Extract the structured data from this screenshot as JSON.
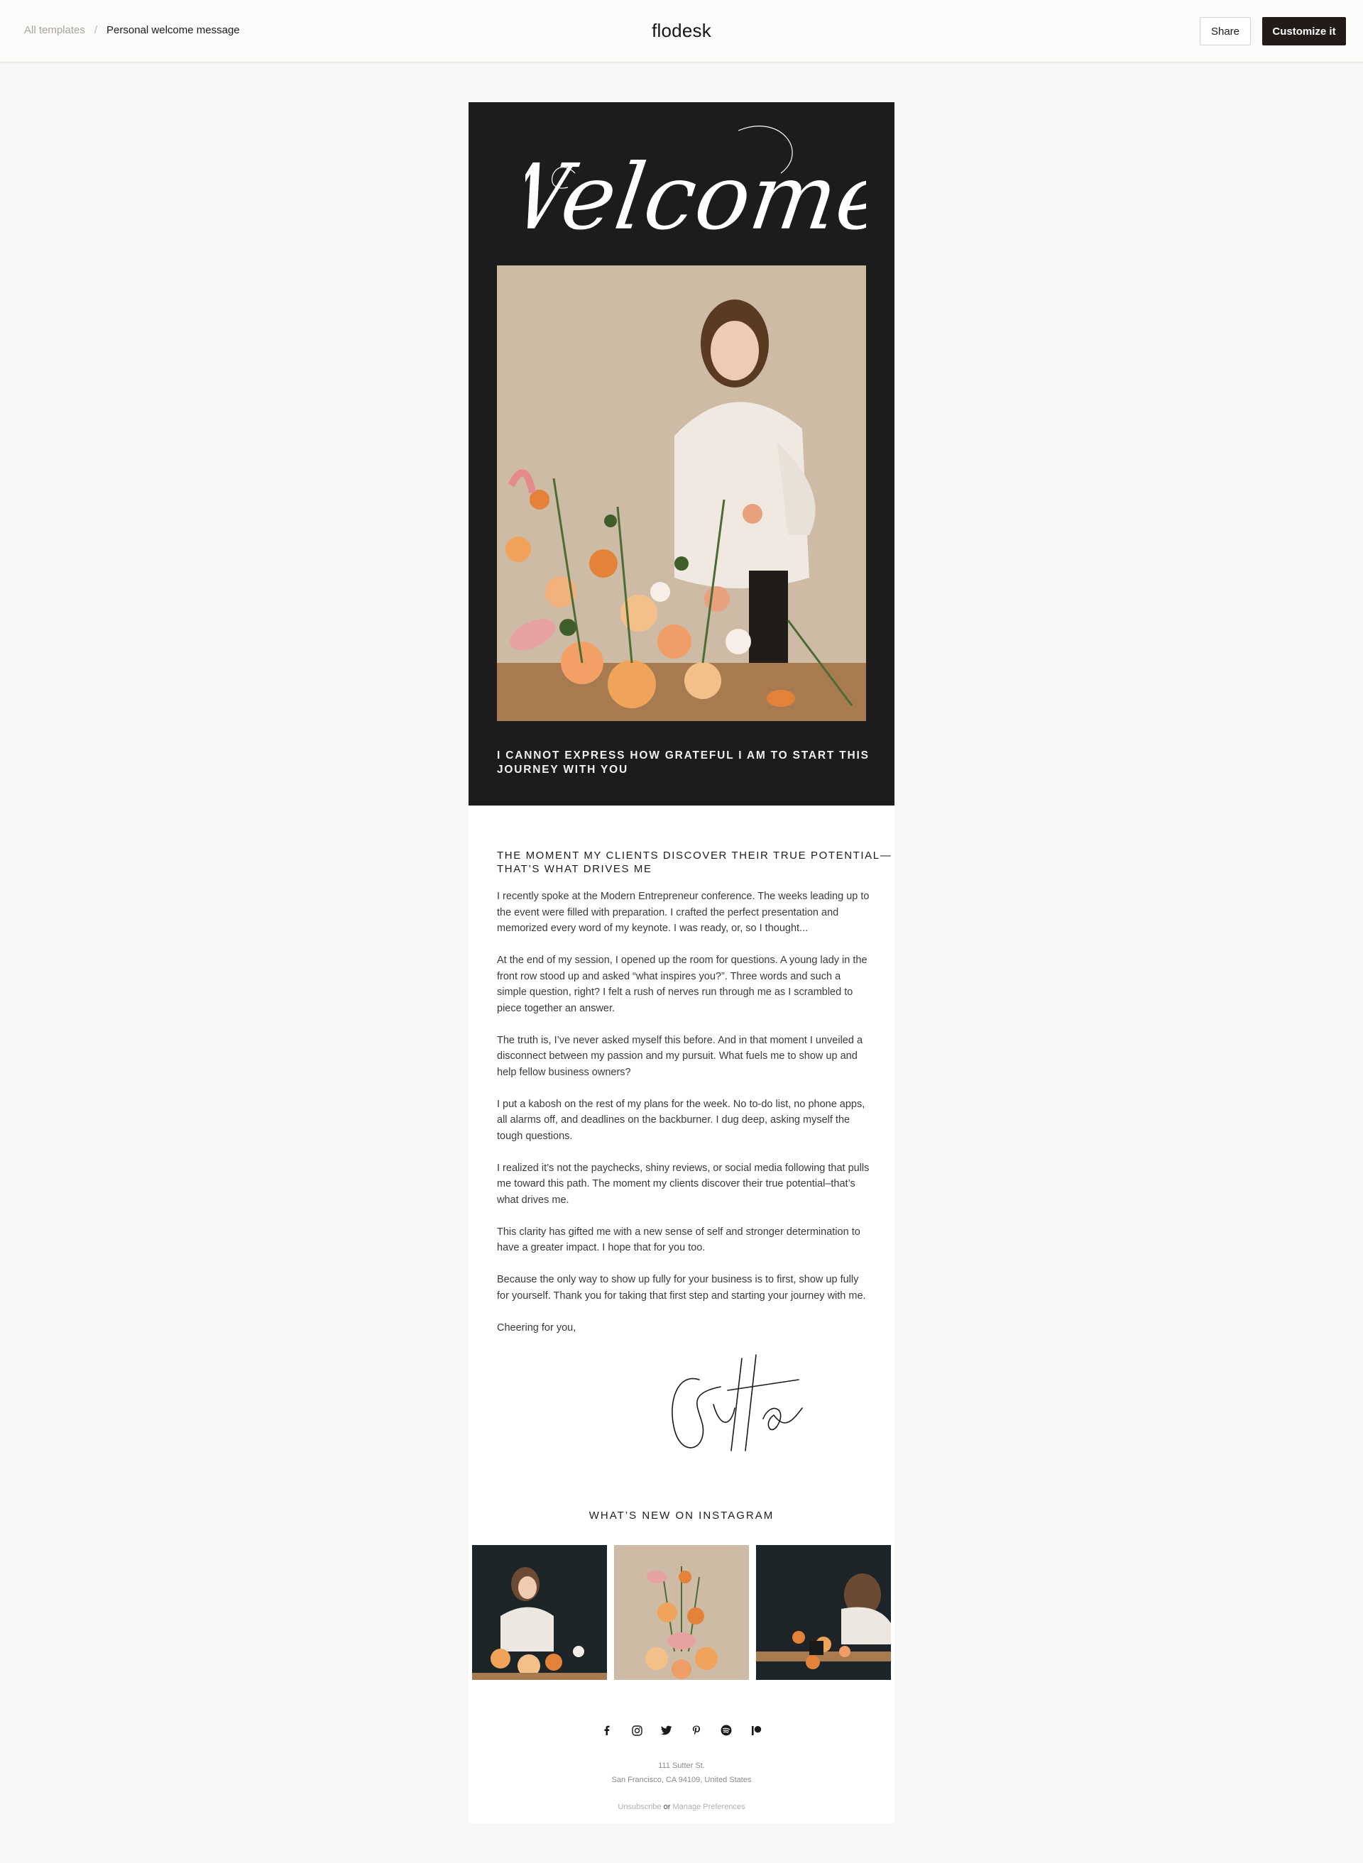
{
  "header": {
    "breadcrumb_root": "All templates",
    "breadcrumb_separator": "/",
    "breadcrumb_current": "Personal welcome message",
    "brand": "flodesk",
    "share_label": "Share",
    "customize_label": "Customize it"
  },
  "email": {
    "hero_script": "Welcome",
    "hero_caption": "I CANNOT EXPRESS HOW GRATEFUL I AM TO START THIS JOURNEY WITH YOU",
    "section_heading": "THE MOMENT MY CLIENTS DISCOVER THEIR TRUE POTENTIAL—THAT’S WHAT DRIVES ME",
    "paragraphs": [
      "I recently spoke at the Modern Entrepreneur conference. The weeks leading up to the event were filled with preparation. I crafted the perfect presentation and memorized every word of my keynote. I was ready, or, so I thought...",
      "At the end of my session, I opened up the room for questions. A young lady in the front row stood up and asked “what inspires you?”. Three words and such a simple question, right? I felt a rush of nerves run through me as I scrambled to piece together an answer.",
      "The truth is, I’ve never asked myself this before. And in that moment I unveiled a disconnect between my passion and my pursuit. What fuels me to show up and help fellow business owners?",
      "I put a kabosh on the rest of my plans for the week. No to-do list, no phone apps, all alarms off, and deadlines on the backburner. I dug deep, asking myself the tough questions.",
      "I realized it’s not the paychecks, shiny reviews, or social media following that pulls me toward this path. The moment my clients discover their true potential–that’s what drives me.",
      "This clarity has gifted me with a new sense of self and stronger determination to have a greater impact. I hope that for you too.",
      "Because the only way to show up fully for your business is to first, show up fully for yourself. Thank you for taking that first step and starting your journey with me.",
      "Cheering for you,"
    ],
    "signature": "Sutton",
    "instagram_heading": "WHAT’S NEW ON INSTAGRAM",
    "social_icons": [
      "facebook-icon",
      "instagram-icon",
      "twitter-icon",
      "pinterest-icon",
      "spotify-icon",
      "patreon-icon"
    ],
    "address_line1": "111 Sutter St.",
    "address_line2": "San Francisco, CA 94109, United States",
    "unsubscribe": "Unsubscribe",
    "or": "or",
    "manage_preferences": "Manage Preferences"
  },
  "colors": {
    "hero_bg": "#1c1c1c",
    "page_bg": "#f7f7f7",
    "primary_button": "#231b1a"
  }
}
